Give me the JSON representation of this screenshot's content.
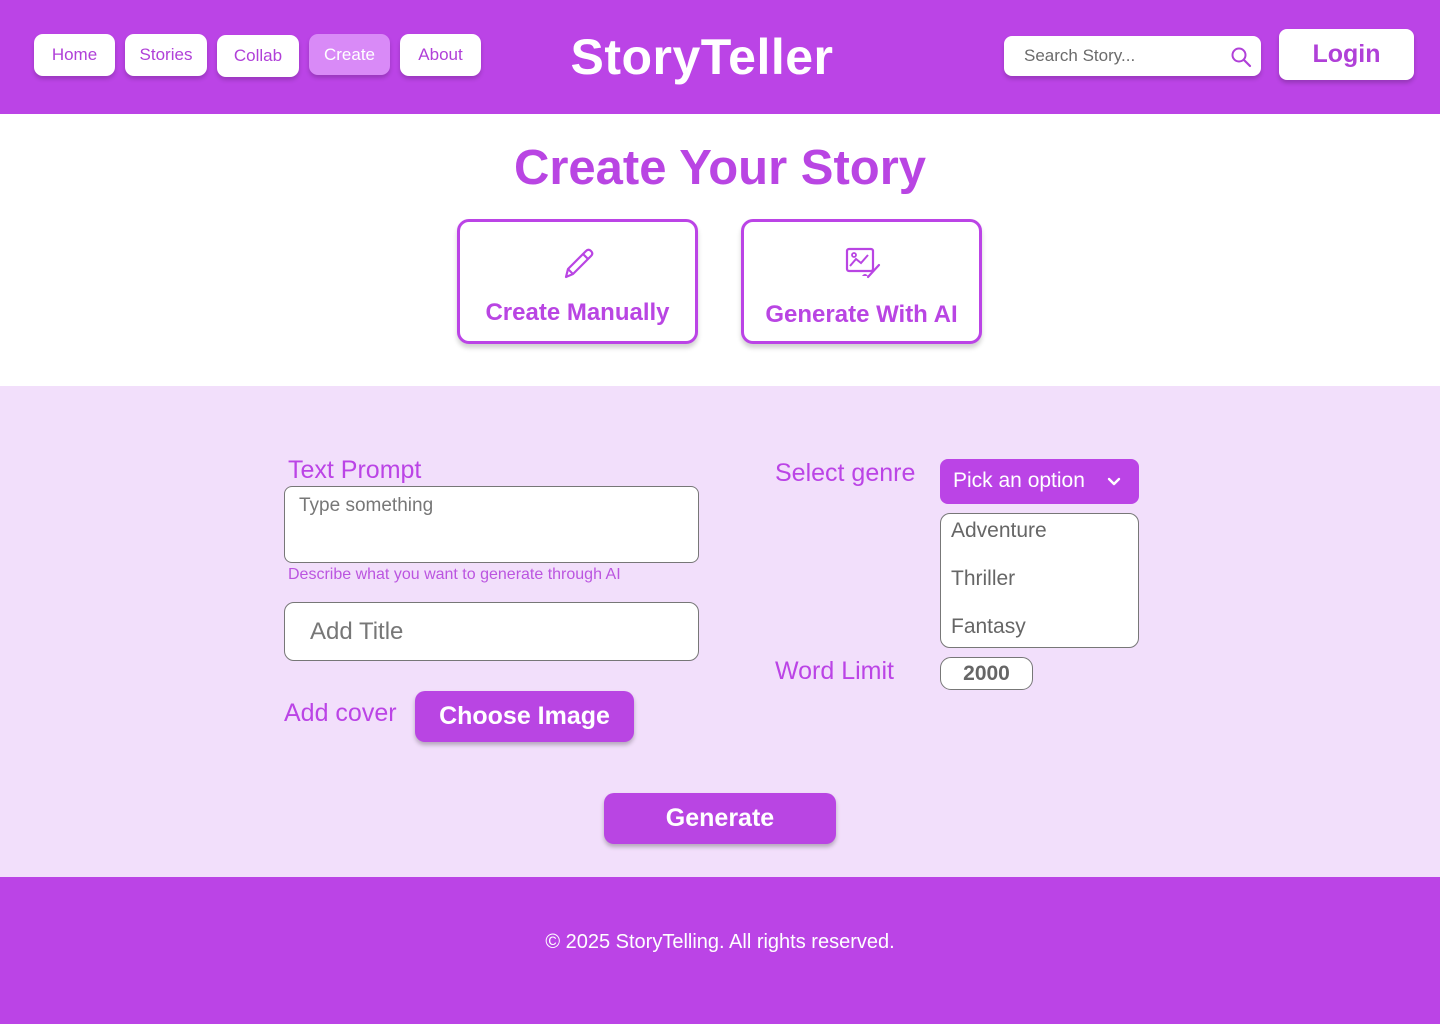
{
  "colors": {
    "primary": "#bb44e6",
    "active_nav": "#d98af7",
    "form_bg": "#f2dffb"
  },
  "nav": {
    "items": [
      {
        "label": "Home",
        "active": false
      },
      {
        "label": "Stories",
        "active": false
      },
      {
        "label": "Collab",
        "active": false
      },
      {
        "label": "Create",
        "active": true
      },
      {
        "label": "About",
        "active": false
      }
    ]
  },
  "header": {
    "brand": "StoryTeller",
    "search_placeholder": "Search Story...",
    "login_label": "Login",
    "search_icon": "search-icon"
  },
  "main": {
    "title": "Create Your Story",
    "modes": [
      {
        "label": "Create Manually",
        "icon": "pencil-icon"
      },
      {
        "label": "Generate With AI",
        "icon": "ai-image-icon"
      }
    ]
  },
  "form": {
    "prompt_label": "Text Prompt",
    "prompt_placeholder": "Type something",
    "prompt_helper": "Describe what you want to generate through AI",
    "title_placeholder": "Add Title",
    "cover_label": "Add cover",
    "choose_image_label": "Choose Image",
    "genre_label": "Select genre",
    "genre_select_value": "Pick an option",
    "genre_options": [
      "Adventure",
      "Thriller",
      "Fantasy"
    ],
    "word_limit_label": "Word Limit",
    "word_limit_value": "2000",
    "generate_label": "Generate"
  },
  "footer": {
    "copyright": "© 2025 StoryTelling. All rights reserved."
  }
}
